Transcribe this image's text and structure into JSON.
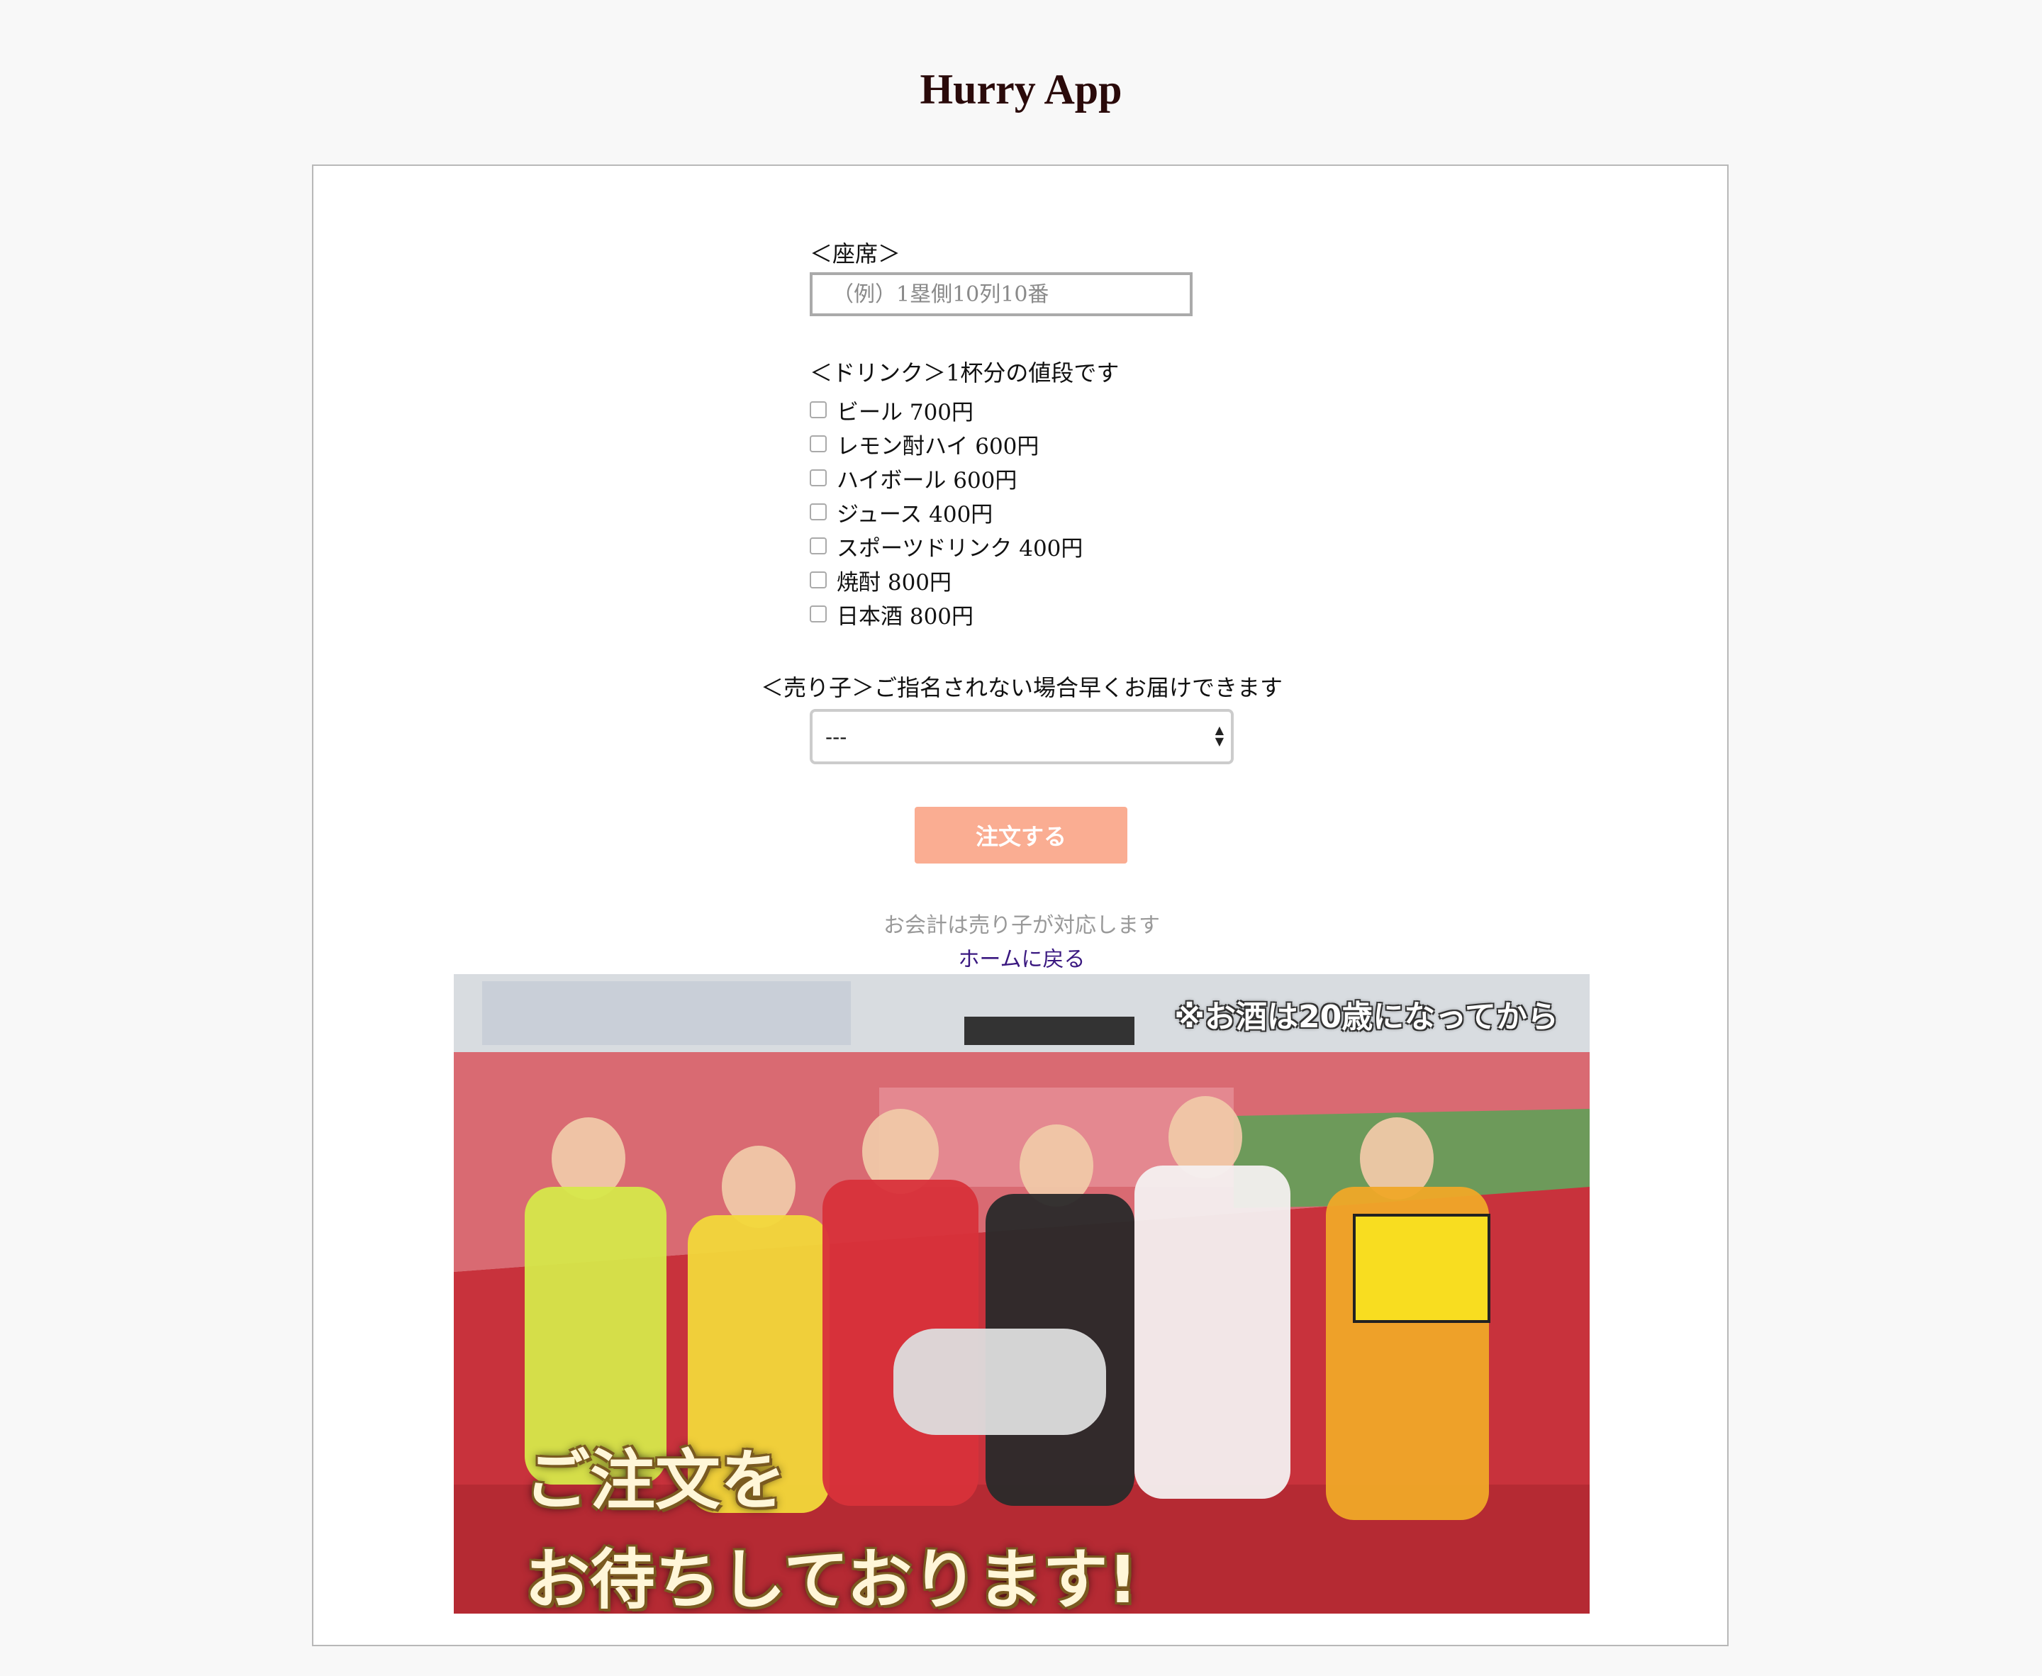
{
  "app": {
    "title": "Hurry App"
  },
  "form": {
    "seat_label": "＜座席＞",
    "seat_placeholder": "（例）1塁側10列10番",
    "drink_label": "＜ドリンク＞1杯分の値段です",
    "drinks": [
      {
        "label": "ビール 700円",
        "checked": false
      },
      {
        "label": "レモン酎ハイ 600円",
        "checked": false
      },
      {
        "label": "ハイボール 600円",
        "checked": false
      },
      {
        "label": "ジュース 400円",
        "checked": false
      },
      {
        "label": "スポーツドリンク 400円",
        "checked": false
      },
      {
        "label": "焼酎 800円",
        "checked": false
      },
      {
        "label": "日本酒 800円",
        "checked": false
      }
    ],
    "seller_label": "＜売り子＞ご指名されない場合早くお届けできます",
    "seller_selected": "---",
    "submit_label": "注文する",
    "note": "お会計は売り子が対応します",
    "home_link": "ホームに戻る"
  },
  "banner": {
    "notice": "※お酒は20歳になってから",
    "line1": "ご注文を",
    "line2": "お待ちしております!",
    "colors": {
      "seats": "#c8323c",
      "field": "#5a8c4a",
      "sky": "#f0f0f0"
    }
  }
}
